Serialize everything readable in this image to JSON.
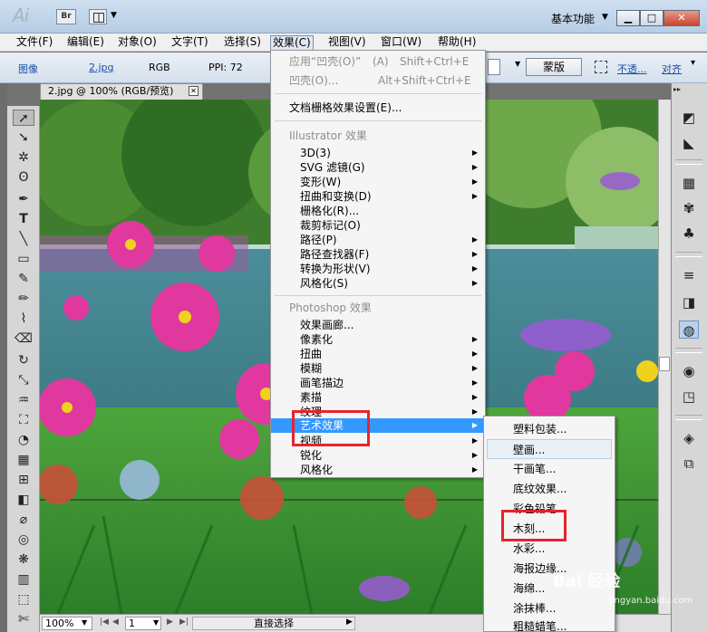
{
  "app": {
    "logo": "Ai",
    "bridge_label": "Br",
    "workspace": "基本功能",
    "window_controls": {
      "minimize": "▁",
      "maximize": "□",
      "close": "✕"
    }
  },
  "menubar": {
    "items": [
      "文件(F)",
      "编辑(E)",
      "对象(O)",
      "文字(T)",
      "选择(S)",
      "效果(C)",
      "视图(V)",
      "窗口(W)",
      "帮助(H)"
    ]
  },
  "control_bar": {
    "type": "图像",
    "filename": "2.jpg",
    "color_mode": "RGB",
    "ppi": "PPI: 72",
    "mask_button": "蒙版",
    "opacity_link": "不透...",
    "align_link": "对齐"
  },
  "document": {
    "tab_title": "2.jpg @ 100% (RGB/预览)",
    "tab_close": "✕"
  },
  "status_bar": {
    "zoom": "100%",
    "artboard": "1",
    "tool_name": "直接选择"
  },
  "effect_menu": {
    "apply_last": "应用“凹壳(O)”",
    "apply_last_key": "(A)",
    "apply_last_shortcut": "Shift+Ctrl+E",
    "last_effect": "凹壳(O)...",
    "last_effect_shortcut": "Alt+Shift+Ctrl+E",
    "raster_settings": "文档栅格效果设置(E)...",
    "illustrator_header": "Illustrator 效果",
    "illustrator_items": [
      "3D(3)",
      "SVG 滤镜(G)",
      "变形(W)",
      "扭曲和变换(D)",
      "栅格化(R)...",
      "裁剪标记(O)",
      "路径(P)",
      "路径查找器(F)",
      "转换为形状(V)",
      "风格化(S)"
    ],
    "photoshop_header": "Photoshop 效果",
    "photoshop_items": [
      "效果画廊...",
      "像素化",
      "扭曲",
      "模糊",
      "画笔描边",
      "素描",
      "纹理",
      "艺术效果",
      "视频",
      "锐化",
      "风格化"
    ]
  },
  "artistic_menu": {
    "items": [
      "塑料包装...",
      "壁画...",
      "干画笔...",
      "底纹效果...",
      "彩色铅笔...",
      "木刻...",
      "水彩...",
      "海报边缘...",
      "海绵...",
      "涂抹棒...",
      "粗糙蜡笔..."
    ]
  },
  "watermark": {
    "text": "Bai 经验",
    "sub": "jingyan.baidu.com"
  },
  "colors": {
    "menu_highlight": "#3399ff",
    "annotation_red": "#e8232a",
    "titlebar": "#c5d8ec"
  }
}
